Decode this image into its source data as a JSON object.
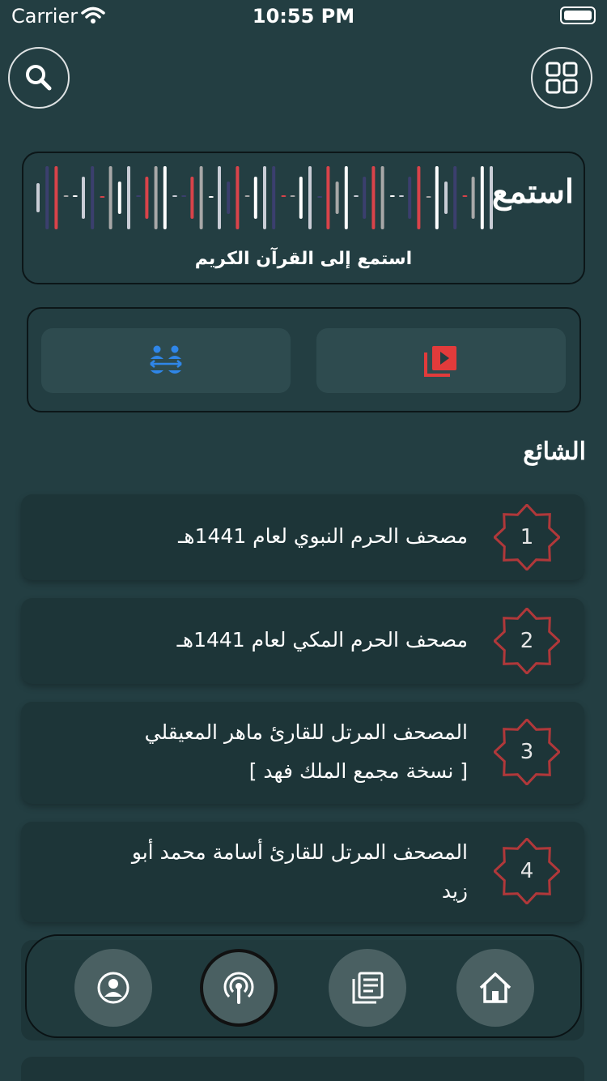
{
  "status_bar": {
    "carrier": "Carrier",
    "time": "10:55 PM"
  },
  "header": {
    "search_icon": "search-icon",
    "menu_icon": "grid-icon"
  },
  "listen_card": {
    "title": "استمع",
    "subtitle": "استمع إلى القرآن الكريم"
  },
  "quick_actions": {
    "left_icon": "people-icon",
    "right_icon": "video-library-icon",
    "left_color": "#2f86e8",
    "right_color": "#e23b3b"
  },
  "trending": {
    "title": "الشائع",
    "items": [
      {
        "rank": "1",
        "title": "مصحف الحرم النبوي لعام 1441هـ",
        "subtitle": ""
      },
      {
        "rank": "2",
        "title": "مصحف الحرم المكي لعام 1441هـ",
        "subtitle": ""
      },
      {
        "rank": "3",
        "title": "المصحف المرتل للقارئ ماهر المعيقلي",
        "subtitle": "[ نسخة مجمع الملك فهد ]"
      },
      {
        "rank": "4",
        "title": "المصحف المرتل للقارئ أسامة محمد أبو",
        "subtitle": "زيد"
      }
    ]
  },
  "nav": {
    "items": [
      "profile-icon",
      "podcast-icon",
      "book-icon",
      "home-icon"
    ],
    "active": "podcast-icon"
  },
  "colors": {
    "background": "#233e42",
    "card": "#1d3538",
    "badge_stroke": "#b0383a",
    "accent_red": "#e23b3b",
    "accent_blue": "#2f86e8"
  }
}
